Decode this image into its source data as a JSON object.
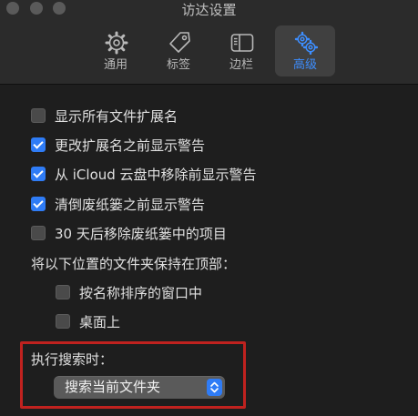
{
  "window": {
    "title": "访达设置"
  },
  "toolbar": {
    "tabs": [
      {
        "label": "通用",
        "icon": "gear-icon"
      },
      {
        "label": "标签",
        "icon": "tag-icon"
      },
      {
        "label": "边栏",
        "icon": "sidebar-icon"
      },
      {
        "label": "高级",
        "icon": "gears-icon",
        "active": true
      }
    ]
  },
  "options": [
    {
      "label": "显示所有文件扩展名",
      "checked": false
    },
    {
      "label": "更改扩展名之前显示警告",
      "checked": true
    },
    {
      "label": "从 iCloud 云盘中移除前显示警告",
      "checked": true
    },
    {
      "label": "清倒废纸篓之前显示警告",
      "checked": true
    },
    {
      "label": "30 天后移除废纸篓中的项目",
      "checked": false
    }
  ],
  "keep_folders": {
    "heading": "将以下位置的文件夹保持在顶部：",
    "items": [
      {
        "label": "按名称排序的窗口中",
        "checked": false
      },
      {
        "label": "桌面上",
        "checked": false
      }
    ]
  },
  "search": {
    "heading": "执行搜索时：",
    "selected": "搜索当前文件夹"
  },
  "colors": {
    "accent": "#2f7cf6",
    "annotation": "#c0221f"
  }
}
